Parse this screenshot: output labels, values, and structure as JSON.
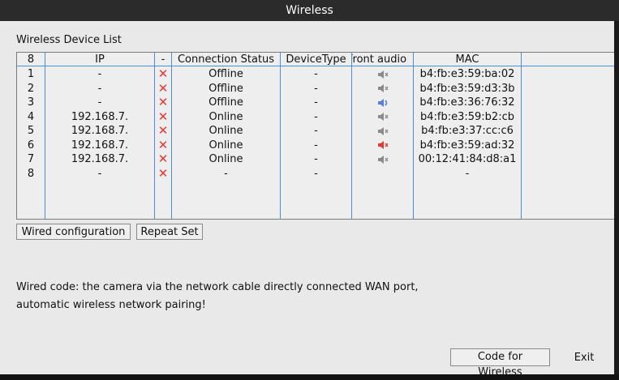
{
  "window": {
    "title": "Wireless"
  },
  "section_label": "Wireless Device List",
  "table": {
    "headers": [
      "8",
      "IP",
      "-",
      "Connection Status",
      "DeviceType",
      "Front audio",
      "MAC"
    ],
    "rows": [
      {
        "num": "1",
        "ip": "-",
        "status": "Offline",
        "device_type": "-",
        "audio": "muted",
        "mac": "b4:fb:e3:59:ba:02"
      },
      {
        "num": "2",
        "ip": "-",
        "status": "Offline",
        "device_type": "-",
        "audio": "muted",
        "mac": "b4:fb:e3:59:d3:3b"
      },
      {
        "num": "3",
        "ip": "-",
        "status": "Offline",
        "device_type": "-",
        "audio": "on",
        "mac": "b4:fb:e3:36:76:32"
      },
      {
        "num": "4",
        "ip": "192.168.7.",
        "status": "Online",
        "device_type": "-",
        "audio": "muted",
        "mac": "b4:fb:e3:59:b2:cb"
      },
      {
        "num": "5",
        "ip": "192.168.7.",
        "status": "Online",
        "device_type": "-",
        "audio": "muted",
        "mac": "b4:fb:e3:37:cc:c6"
      },
      {
        "num": "6",
        "ip": "192.168.7.",
        "status": "Online",
        "device_type": "-",
        "audio": "muted-red",
        "mac": "b4:fb:e3:59:ad:32"
      },
      {
        "num": "7",
        "ip": "192.168.7.",
        "status": "Online",
        "device_type": "-",
        "audio": "muted",
        "mac": "00:12:41:84:d8:a1"
      },
      {
        "num": "8",
        "ip": "-",
        "status": "-",
        "device_type": "-",
        "audio": "none",
        "mac": "-"
      }
    ]
  },
  "buttons": {
    "wired_config": "Wired configuration",
    "repeat_set": "Repeat Set",
    "code_for_wireless": "Code for Wireless",
    "exit": "Exit"
  },
  "note": "Wired code: the camera via the network cable directly connected WAN port, automatic wireless network pairing!",
  "colors": {
    "grid_line": "#4a90d9",
    "x_mark": "#e23838",
    "audio_on": "#5a7fe0",
    "audio_red": "#e23838",
    "audio_muted": "#8a8a8a"
  }
}
